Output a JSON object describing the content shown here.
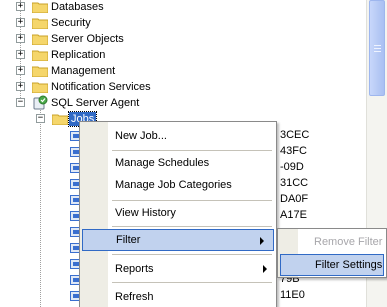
{
  "tree": {
    "nodes": [
      {
        "label": "Databases",
        "expander": "+"
      },
      {
        "label": "Security",
        "expander": "+"
      },
      {
        "label": "Server Objects",
        "expander": "+"
      },
      {
        "label": "Replication",
        "expander": "+"
      },
      {
        "label": "Management",
        "expander": "+"
      },
      {
        "label": "Notification Services",
        "expander": "+"
      },
      {
        "label": "SQL Server Agent",
        "expander": "−"
      },
      {
        "label": "Jobs",
        "expander": "−"
      }
    ],
    "job_ids": [
      "3CEC",
      "43FC",
      "-09D",
      "31CC",
      "DA0F",
      "A17E",
      "",
      "",
      "",
      "79B",
      "11E0"
    ]
  },
  "context_menu": {
    "items": {
      "new_job": "New Job...",
      "manage_schedules": "Manage Schedules",
      "manage_job_categories": "Manage Job Categories",
      "view_history": "View History",
      "filter": "Filter",
      "reports": "Reports",
      "refresh": "Refresh"
    }
  },
  "filter_submenu": {
    "remove_filter": "Remove Filter",
    "filter_settings": "Filter Settings"
  },
  "colors": {
    "selection": "#316ac5",
    "menu_highlight": "#c1d2ee",
    "menu_gutter": "#eeede5"
  }
}
